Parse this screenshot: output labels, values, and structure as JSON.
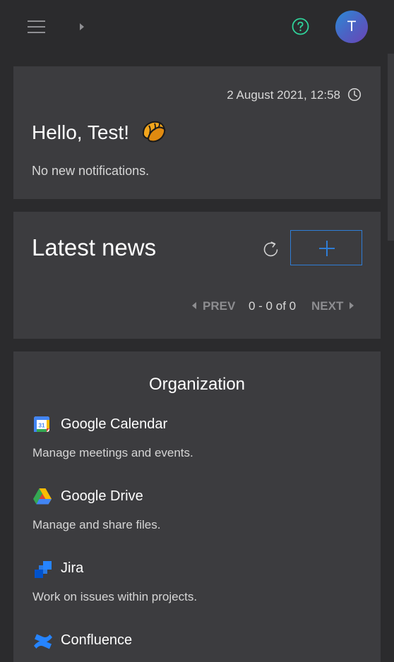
{
  "header": {
    "menu_icon": "hamburger-menu-icon",
    "expand_icon": "caret-right-icon",
    "help_icon": "question-circle-icon",
    "avatar_initial": "T"
  },
  "welcome": {
    "datetime": "2 August 2021, 12:58",
    "clock_icon": "clock-icon",
    "greeting": "Hello, Test!",
    "greeting_icon": "croissant-icon",
    "notifications": "No new notifications."
  },
  "news": {
    "title": "Latest news",
    "refresh_icon": "refresh-icon",
    "add_icon": "plus-icon",
    "prev_label": "PREV",
    "page_info": "0 - 0 of 0",
    "next_label": "NEXT"
  },
  "organization": {
    "title": "Organization",
    "apps": [
      {
        "name": "Google Calendar",
        "description": "Manage meetings and events.",
        "icon": "google-calendar-icon"
      },
      {
        "name": "Google Drive",
        "description": "Manage and share files.",
        "icon": "google-drive-icon"
      },
      {
        "name": "Jira",
        "description": "Work on issues within projects.",
        "icon": "jira-icon"
      },
      {
        "name": "Confluence",
        "description": "",
        "icon": "confluence-icon"
      }
    ]
  },
  "colors": {
    "page_bg": "#2b2b2d",
    "card_bg": "#3c3c3f",
    "accent_blue": "#2f7dd6",
    "help_green": "#2fd39a"
  }
}
